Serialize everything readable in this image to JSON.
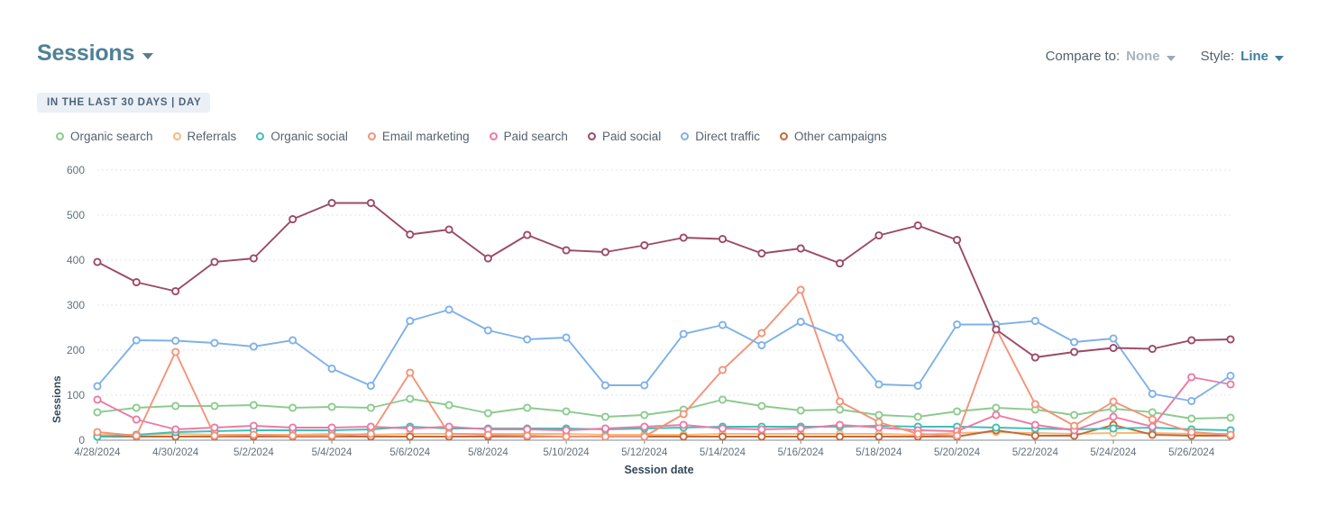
{
  "header": {
    "title": "Sessions",
    "title_caret_icon": "chevron-down-icon",
    "compare_label": "Compare to:",
    "compare_value": "None",
    "style_label": "Style:",
    "style_value": "Line",
    "date_range_pill": "IN THE LAST 30 DAYS | DAY"
  },
  "colors": {
    "organic_search": "#8ccb8f",
    "referrals": "#f4b97a",
    "organic_social": "#3fbfb6",
    "email_marketing": "#f3937a",
    "paid_search": "#ea7ba4",
    "paid_social": "#9c4a66",
    "direct_traffic": "#7fb1e8",
    "other_campaigns": "#c2693c",
    "title": "#4f8196",
    "pill_bg": "#eaf0f6",
    "grid": "#dfe3eb",
    "axis": "#7c8b99"
  },
  "chart_data": {
    "type": "line",
    "title": "",
    "xlabel": "Session date",
    "ylabel": "Sessions",
    "ylim": [
      0,
      600
    ],
    "yticks": [
      0,
      100,
      200,
      300,
      400,
      500,
      600
    ],
    "grid": true,
    "legend_position": "top-left",
    "x": [
      "4/28/2024",
      "4/29/2024",
      "4/30/2024",
      "5/1/2024",
      "5/2/2024",
      "5/3/2024",
      "5/4/2024",
      "5/5/2024",
      "5/6/2024",
      "5/7/2024",
      "5/8/2024",
      "5/9/2024",
      "5/10/2024",
      "5/11/2024",
      "5/12/2024",
      "5/13/2024",
      "5/14/2024",
      "5/15/2024",
      "5/16/2024",
      "5/17/2024",
      "5/18/2024",
      "5/19/2024",
      "5/20/2024",
      "5/21/2024",
      "5/22/2024",
      "5/23/2024",
      "5/24/2024",
      "5/25/2024",
      "5/26/2024",
      "5/27/2024"
    ],
    "xtick_labels": [
      "4/28/2024",
      "4/30/2024",
      "5/2/2024",
      "5/4/2024",
      "5/6/2024",
      "5/8/2024",
      "5/10/2024",
      "5/12/2024",
      "5/14/2024",
      "5/16/2024",
      "5/18/2024",
      "5/20/2024",
      "5/22/2024",
      "5/24/2024",
      "5/26/2024"
    ],
    "series": [
      {
        "name": "Organic search",
        "color": "#8ccb8f",
        "values": [
          62,
          72,
          76,
          76,
          78,
          72,
          74,
          72,
          92,
          78,
          60,
          72,
          64,
          52,
          56,
          68,
          90,
          76,
          66,
          68,
          56,
          52,
          64,
          72,
          68,
          56,
          70,
          62,
          48,
          50
        ]
      },
      {
        "name": "Referrals",
        "color": "#f4b97a",
        "values": [
          12,
          12,
          14,
          12,
          12,
          12,
          14,
          12,
          14,
          14,
          14,
          14,
          14,
          12,
          12,
          12,
          14,
          14,
          14,
          14,
          14,
          12,
          16,
          18,
          16,
          14,
          16,
          16,
          14,
          14
        ]
      },
      {
        "name": "Organic social",
        "color": "#3fbfb6",
        "values": [
          8,
          12,
          18,
          20,
          22,
          22,
          22,
          24,
          30,
          26,
          26,
          26,
          26,
          24,
          26,
          28,
          30,
          30,
          30,
          30,
          32,
          30,
          30,
          28,
          26,
          24,
          26,
          28,
          24,
          22
        ]
      },
      {
        "name": "Email marketing",
        "color": "#f3937a",
        "values": [
          18,
          10,
          196,
          10,
          12,
          10,
          10,
          14,
          150,
          14,
          12,
          10,
          8,
          8,
          8,
          58,
          156,
          238,
          334,
          86,
          40,
          14,
          10,
          248,
          80,
          32,
          86,
          46,
          18,
          12
        ]
      },
      {
        "name": "Paid search",
        "color": "#ea7ba4",
        "values": [
          90,
          46,
          24,
          28,
          32,
          28,
          28,
          30,
          26,
          30,
          24,
          24,
          22,
          26,
          30,
          34,
          26,
          24,
          26,
          34,
          28,
          22,
          20,
          56,
          34,
          22,
          52,
          30,
          140,
          124
        ]
      },
      {
        "name": "Paid social",
        "color": "#9c4a66",
        "values": [
          396,
          351,
          331,
          396,
          404,
          491,
          527,
          527,
          457,
          468,
          404,
          456,
          422,
          418,
          433,
          450,
          447,
          415,
          426,
          393,
          455,
          477,
          445,
          246,
          184,
          196,
          205,
          203,
          222,
          224
        ]
      },
      {
        "name": "Direct traffic",
        "color": "#7fb1e8",
        "values": [
          120,
          222,
          221,
          216,
          208,
          222,
          159,
          121,
          265,
          290,
          244,
          224,
          228,
          122,
          122,
          236,
          256,
          211,
          263,
          228,
          124,
          121,
          257,
          257,
          265,
          218,
          226,
          103,
          87,
          143
        ]
      },
      {
        "name": "Other campaigns",
        "color": "#c2693c",
        "values": [
          8,
          8,
          8,
          8,
          8,
          8,
          8,
          8,
          8,
          8,
          8,
          8,
          8,
          8,
          8,
          8,
          8,
          8,
          8,
          8,
          8,
          8,
          8,
          22,
          10,
          10,
          34,
          12,
          10,
          10
        ]
      }
    ]
  }
}
